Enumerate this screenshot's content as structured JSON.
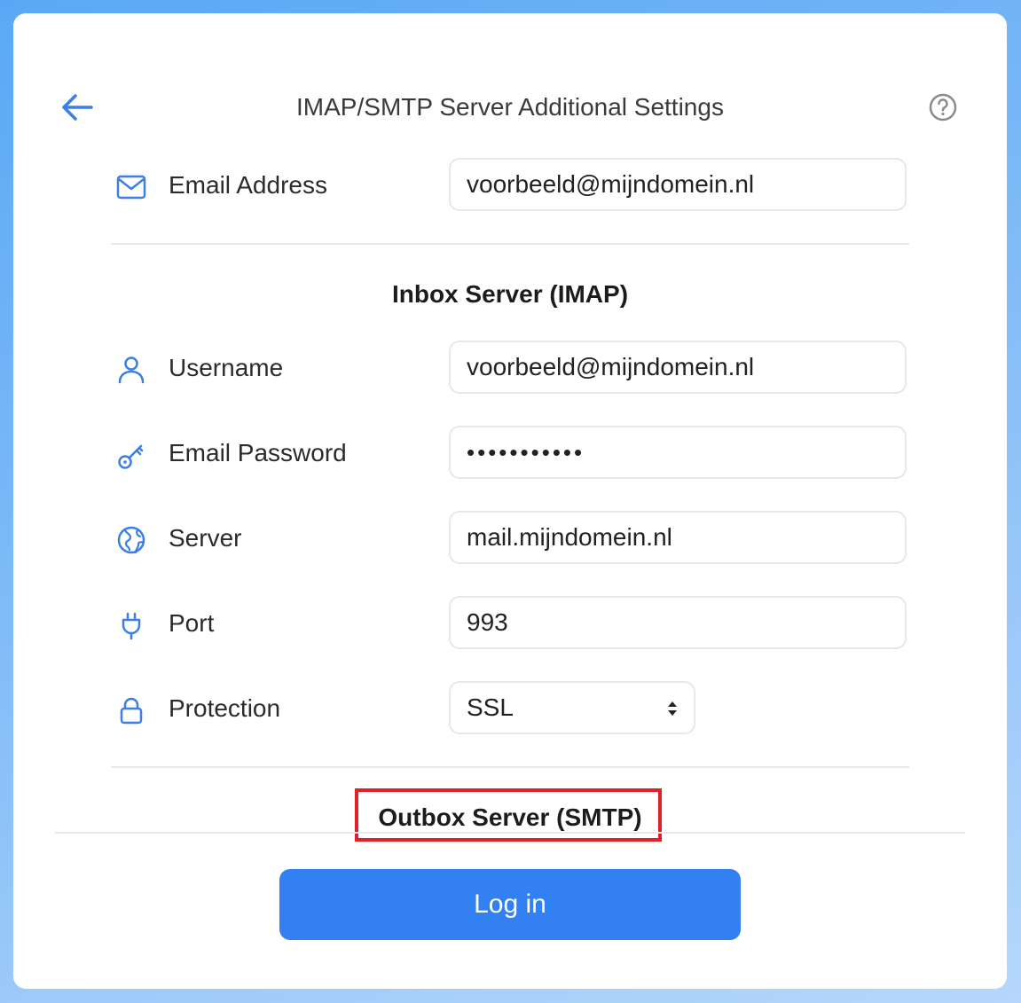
{
  "header": {
    "title": "IMAP/SMTP Server Additional Settings"
  },
  "email_address": {
    "label": "Email Address",
    "value": "voorbeeld@mijndomein.nl"
  },
  "inbox": {
    "heading": "Inbox Server (IMAP)",
    "username": {
      "label": "Username",
      "value": "voorbeeld@mijndomein.nl"
    },
    "password": {
      "label": "Email Password",
      "value": "•••••••••••"
    },
    "server": {
      "label": "Server",
      "value": "mail.mijndomein.nl"
    },
    "port": {
      "label": "Port",
      "value": "993"
    },
    "protection": {
      "label": "Protection",
      "selected": "SSL"
    }
  },
  "outbox": {
    "heading": "Outbox Server (SMTP)",
    "highlight_color": "#e0202a"
  },
  "actions": {
    "login_label": "Log in"
  },
  "colors": {
    "accent": "#3380f2",
    "icon": "#3d7ee6"
  },
  "icons": [
    "back-arrow-icon",
    "help-icon",
    "envelope-icon",
    "user-icon",
    "key-icon",
    "globe-icon",
    "plug-icon",
    "lock-icon",
    "select-arrows-icon"
  ]
}
